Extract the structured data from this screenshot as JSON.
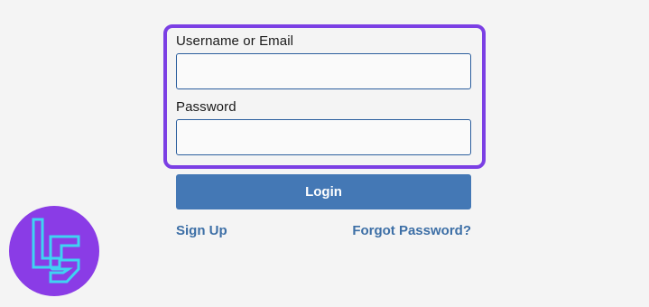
{
  "form": {
    "username_label": "Username or Email",
    "username_value": "",
    "password_label": "Password",
    "password_value": "",
    "login_label": "Login",
    "signup_label": "Sign Up",
    "forgot_label": "Forgot Password?"
  },
  "colors": {
    "highlight": "#7b3fe4",
    "button": "#4478b5",
    "link": "#3d6fa6",
    "logo_bg": "#8a3ce6",
    "logo_mark": "#3fd3f2"
  },
  "logo": {
    "icon": "brand-logo-icon"
  }
}
